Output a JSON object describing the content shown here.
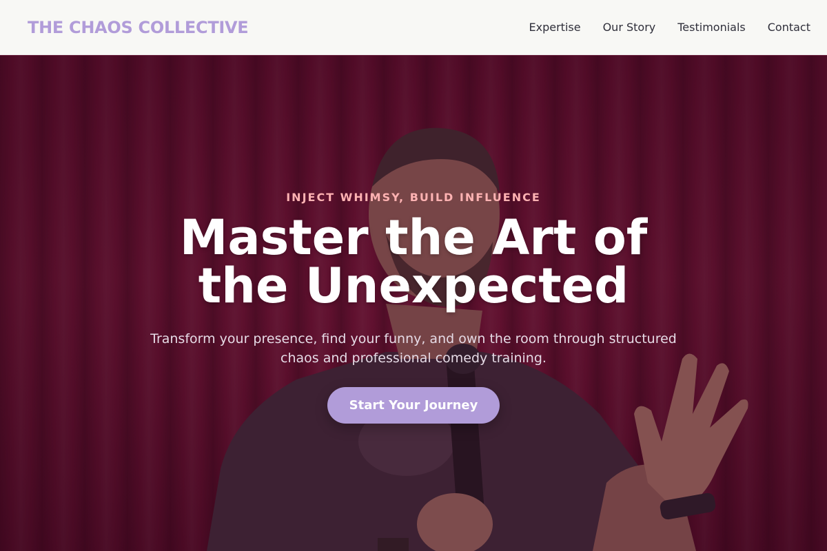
{
  "brand": {
    "name": "THE CHAOS COLLECTIVE",
    "color": "#b19cd9"
  },
  "nav": {
    "items": [
      {
        "label": "Expertise"
      },
      {
        "label": "Our Story"
      },
      {
        "label": "Testimonials"
      },
      {
        "label": "Contact"
      }
    ]
  },
  "hero": {
    "eyebrow": "INJECT WHIMSY, BUILD INFLUENCE",
    "headline": "Master the Art of the Unexpected",
    "subtext": "Transform your presence, find your funny, and own the room through structured chaos and professional comedy training.",
    "cta_label": "Start Your Journey",
    "background_image": "comedian-on-stage-red-curtain",
    "colors": {
      "eyebrow": "#ffb3b3",
      "cta": "#b19cd9",
      "curtain": "#6a1232"
    }
  }
}
